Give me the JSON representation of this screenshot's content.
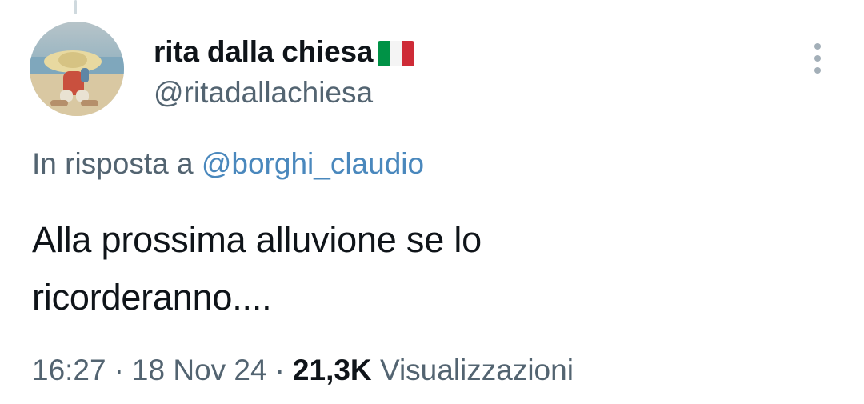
{
  "tweet": {
    "author": {
      "display_name": "rita dalla chiesa",
      "handle": "@ritadallachiesa",
      "flag_icon": "italy-flag-icon",
      "flag_colors": [
        "#009246",
        "#ffffff",
        "#ce2b37"
      ]
    },
    "reply_context": {
      "prefix": "In risposta a",
      "mention": "@borghi_claudio"
    },
    "text_lines": [
      "Alla prossima alluvione se lo",
      "ricorderanno...."
    ],
    "meta": {
      "time": "16:27",
      "separator": "·",
      "date": "18 Nov 24",
      "views_count": "21,3K",
      "views_label": "Visualizzazioni"
    },
    "more_icon": "more-vertical-icon"
  },
  "colors": {
    "text_primary": "#0f1419",
    "text_secondary": "#536471",
    "link": "#4a88bd"
  }
}
